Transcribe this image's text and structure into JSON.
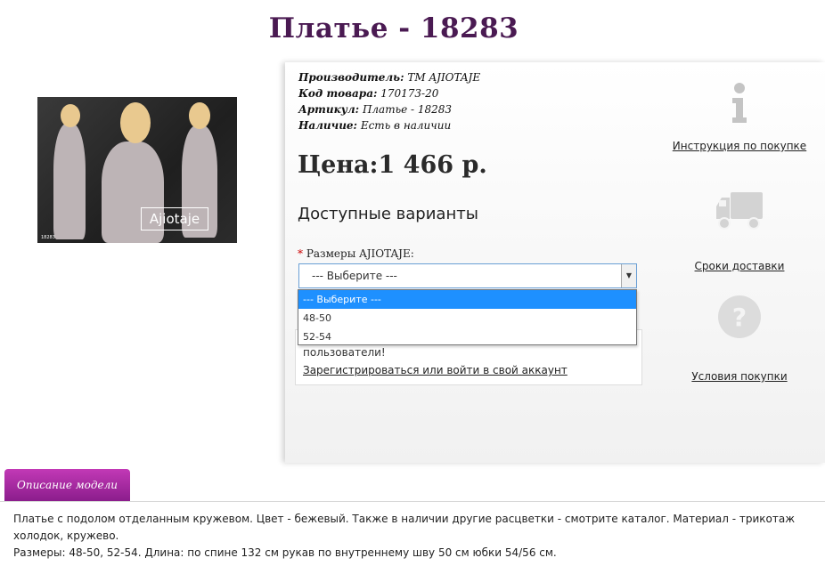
{
  "product": {
    "title": "Платье - 18283",
    "image_logo": "Ajiotaje",
    "image_code": "18283"
  },
  "meta": {
    "manufacturer_label": "Производитель:",
    "manufacturer_value": "ТМ AJIOTAJE",
    "code_label": "Код товара:",
    "code_value": "170173-20",
    "article_label": "Артикул:",
    "article_value": "Платье - 18283",
    "availability_label": "Наличие:",
    "availability_value": "Есть в наличии"
  },
  "price": "Цена:1 466 р.",
  "variants": {
    "title": "Доступные варианты",
    "required_mark": "*",
    "size_label": "Размеры AJIOTAJE:",
    "selected": "--- Выберите ---",
    "options": [
      "--- Выберите ---",
      "48-50",
      "52-54"
    ]
  },
  "login_note": {
    "text": "пользователи!",
    "link": "Зарегистрироваться или войти в свой аккаунт"
  },
  "sidebar": {
    "instruction_link": "Инструкция по покупке",
    "delivery_link": "Сроки доставки",
    "terms_link": "Условия покупки"
  },
  "tab": {
    "label": "Описание модели"
  },
  "description": {
    "line1": "Платье с подолом отделанным кружевом. Цвет - бежевый. Также в наличии другие расцветки - смотрите каталог. Материал - трикотаж холодок, кружево.",
    "line2": "Размеры: 48-50, 52-54. Длина: по спине 132 см рукав по внутреннему шву 50 см юбки 54/56 см."
  },
  "colors": {
    "title": "#4a1a52",
    "tab": "#a92aa3",
    "select_highlight": "#1e90ff"
  }
}
